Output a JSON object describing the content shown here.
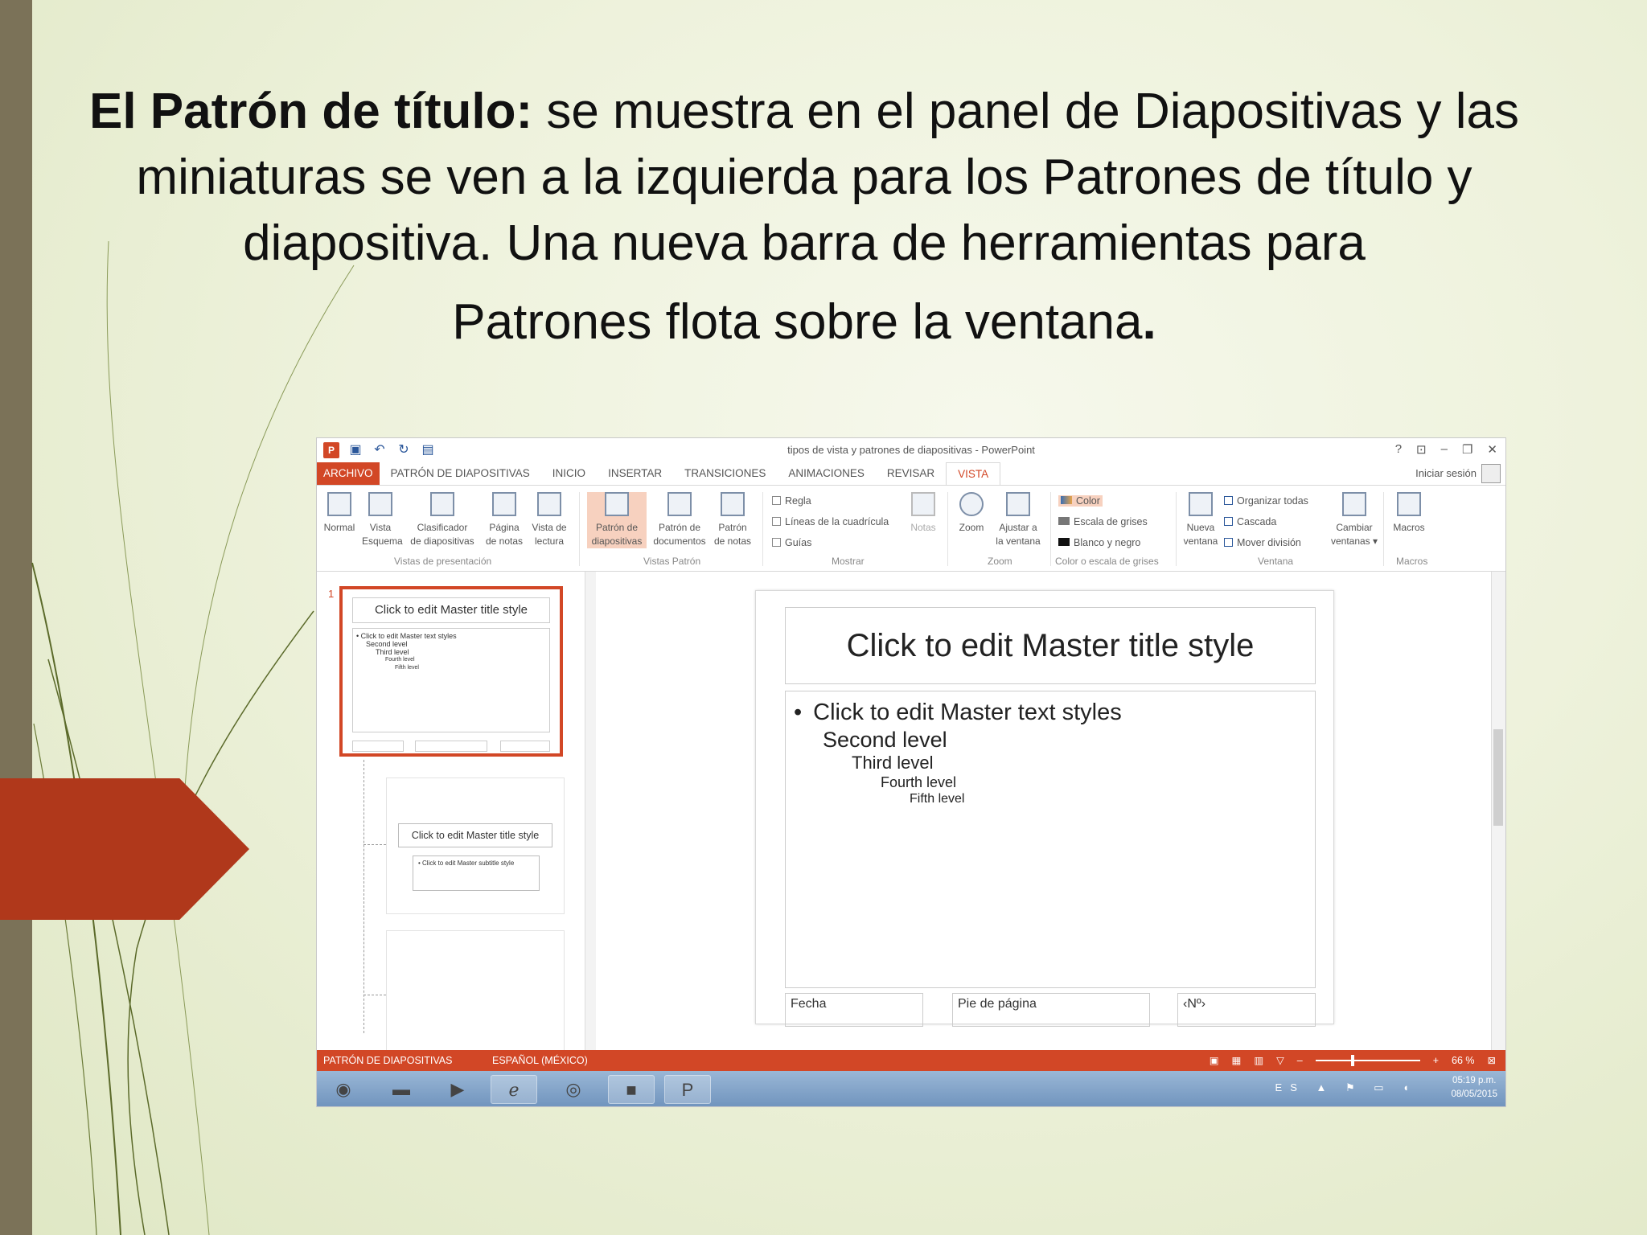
{
  "heading": {
    "bold": "El Patrón de título:",
    "rest": " se muestra en el panel de Diapositivas y las miniaturas se ven a la izquierda para los Patrones de título y diapositiva. Una nueva barra de herramientas para",
    "line2": "Patrones flota sobre la ventana",
    "end_dot": "."
  },
  "colors": {
    "accent": "#d24726",
    "left_bar": "#7b7258",
    "arrow": "#b0381b"
  },
  "window": {
    "title": "tipos de vista y patrones de diapositivas - PowerPoint",
    "controls": [
      "?",
      "⊡",
      "–",
      "❐",
      "✕"
    ],
    "signin": "Iniciar sesión",
    "tabs": [
      "ARCHIVO",
      "PATRÓN DE DIAPOSITIVAS",
      "INICIO",
      "INSERTAR",
      "TRANSICIONES",
      "ANIMACIONES",
      "REVISAR",
      "VISTA"
    ],
    "ribbon": {
      "normal": "Normal",
      "esquema": [
        "Vista",
        "Esquema"
      ],
      "clasificador": [
        "Clasificador",
        "de diapositivas"
      ],
      "pagina_notas": [
        "Página",
        "de notas"
      ],
      "vista_lectura": [
        "Vista de",
        "lectura"
      ],
      "group_presentacion": "Vistas de presentación",
      "patron_diapositivas": [
        "Patrón de",
        "diapositivas"
      ],
      "patron_documentos": [
        "Patrón de",
        "documentos"
      ],
      "patron_notas": [
        "Patrón",
        "de notas"
      ],
      "group_patron": "Vistas Patrón",
      "regla": "Regla",
      "cuadricula": "Líneas de la cuadrícula",
      "guias": "Guías",
      "notas": "Notas",
      "group_mostrar": "Mostrar",
      "zoom": "Zoom",
      "ajustar": [
        "Ajustar a",
        "la ventana"
      ],
      "group_zoom": "Zoom",
      "color": "Color",
      "grises": "Escala de grises",
      "blanco_negro": "Blanco y negro",
      "group_color": "Color o escala de grises",
      "nueva_ventana": [
        "Nueva",
        "ventana"
      ],
      "organizar": "Organizar todas",
      "cascada": "Cascada",
      "mover": "Mover división",
      "cambiar": [
        "Cambiar",
        "ventanas ▾"
      ],
      "group_ventana": "Ventana",
      "macros": "Macros",
      "group_macros": "Macros"
    },
    "thumbnails": {
      "number": "1",
      "title": "Click to edit Master title style",
      "body_lines": [
        "• Click to edit Master text styles",
        "Second level",
        "Third level",
        "Fourth level",
        "Fifth level"
      ],
      "layout_title": "Click to edit Master title style",
      "layout_subtitle": "• Click to edit Master subtitle style"
    },
    "slide": {
      "title": "Click to edit Master title style",
      "level1": "Click to edit Master text styles",
      "level2": "Second level",
      "level3": "Third level",
      "level4": "Fourth level",
      "level5": "Fifth level",
      "date": "Fecha",
      "footer": "Pie de página",
      "number": "‹Nº›"
    },
    "statusbar": {
      "view": "PATRÓN DE DIAPOSITIVAS",
      "language": "ESPAÑOL (MÉXICO)",
      "zoom": "66 %"
    },
    "taskbar": {
      "time": "05:19 p.m.",
      "date": "08/05/2015",
      "lang": "ES"
    }
  }
}
